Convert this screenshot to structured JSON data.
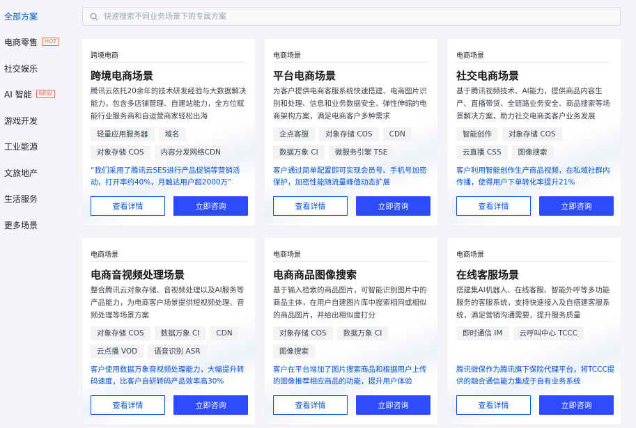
{
  "sidebar": {
    "items": [
      {
        "label": "全部方案",
        "badge": ""
      },
      {
        "label": "电商零售",
        "badge": "HOT"
      },
      {
        "label": "社交娱乐",
        "badge": ""
      },
      {
        "label": "AI 智能",
        "badge": "NEW"
      },
      {
        "label": "游戏开发",
        "badge": ""
      },
      {
        "label": "工业能源",
        "badge": ""
      },
      {
        "label": "文旅地产",
        "badge": ""
      },
      {
        "label": "生活服务",
        "badge": ""
      },
      {
        "label": "更多场景",
        "badge": ""
      }
    ],
    "active_index": 0
  },
  "search": {
    "placeholder": "快速搜索不同业务场景下的专属方案",
    "icon": "search-icon"
  },
  "buttons": {
    "details": "查看详情",
    "consult": "立即咨询"
  },
  "colors": {
    "primary": "#2e4cff",
    "link": "#0052d9",
    "badge": "#ff6a3d"
  },
  "cards": [
    {
      "tag": "跨境电商",
      "title": "跨境电商场景",
      "desc": "腾讯云依托20余年的技术研发经验与大数据解决能力，包含多店铺管理、自建站能力，全方位赋能行业服务商和自运营商家轻松出海",
      "chips": [
        "轻量应用服务器",
        "域名",
        "对象存储 COS",
        "内容分发网络CDN"
      ],
      "quote": "“我们采用了腾讯云SES进行产品促销等营销活动，打开率约40%，月触达用户超2000万”"
    },
    {
      "tag": "电商场景",
      "title": "平台电商场景",
      "desc": "为客户提供电商客服系统快速搭建、电商图片识别和处理、信息和业务数据安全、弹性伸缩的电商架构方案，满足电商客户多种需求",
      "chips": [
        "企点客服",
        "对象存储 COS",
        "CDN",
        "数据万象 CI",
        "微服务引擎 TSE"
      ],
      "quote": "客户通过简单配置即可实现会员号、手机号加密保护，加密性能随流量峰值动态扩展"
    },
    {
      "tag": "电商场景",
      "title": "社交电商场景",
      "desc": "基于腾讯视频技术、AI能力，提供商品内容生产、直播带货、全链路业务安全、商品搜索等场景解决方案，助力社交电商类客户业务发展",
      "chips": [
        "智能创作",
        "对象存储 COS",
        "云直播 CSS",
        "图像搜索"
      ],
      "quote": "客户利用智能创作生产商品视频，在私域社群内传播，使得用户下单转化率提升21%"
    },
    {
      "tag": "电商场景",
      "title": "电商音视频处理场景",
      "desc": "整合腾讯云对象存储、音视频处理以及AI服务等产品能力，为电商客户场景提供短视频处理、音频处理等场景方案",
      "chips": [
        "对象存储 COS",
        "数据万象 CI",
        "CDN",
        "云点播 VOD",
        "语音识别 ASR"
      ],
      "quote": "客户使用数据万象音视频处理能力，大幅提升转码速度，比客户自研转码产品效率高30%"
    },
    {
      "tag": "电商场景",
      "title": "电商商品图像搜索",
      "desc": "基于输入检索的商品图片，可智能识别图片中的商品主体，在用户自建图片库中搜索相同或相似的商品图片，并给出相似度打分",
      "chips": [
        "对象存储 COS",
        "数据万象 CI",
        "图像搜索"
      ],
      "quote": "客户在平台增加了图片搜索商品和根据用户上传的图像推荐相应商品的功能，提升用户体验"
    },
    {
      "tag": "电商场景",
      "title": "在线客服场景",
      "desc": "搭建集AI机器人、在线客服、智能外呼等多功能服务的客服系统，支持快速接入及自搭建客服系统，满足营销沟通需要，提升服务质量",
      "chips": [
        "即时通信 IM",
        "云呼叫中心 TCCC"
      ],
      "quote": "腾讯微保作为腾讯旗下保险代理平台，将TCCC提供的融合通信能力集成于自有业务系统"
    }
  ]
}
